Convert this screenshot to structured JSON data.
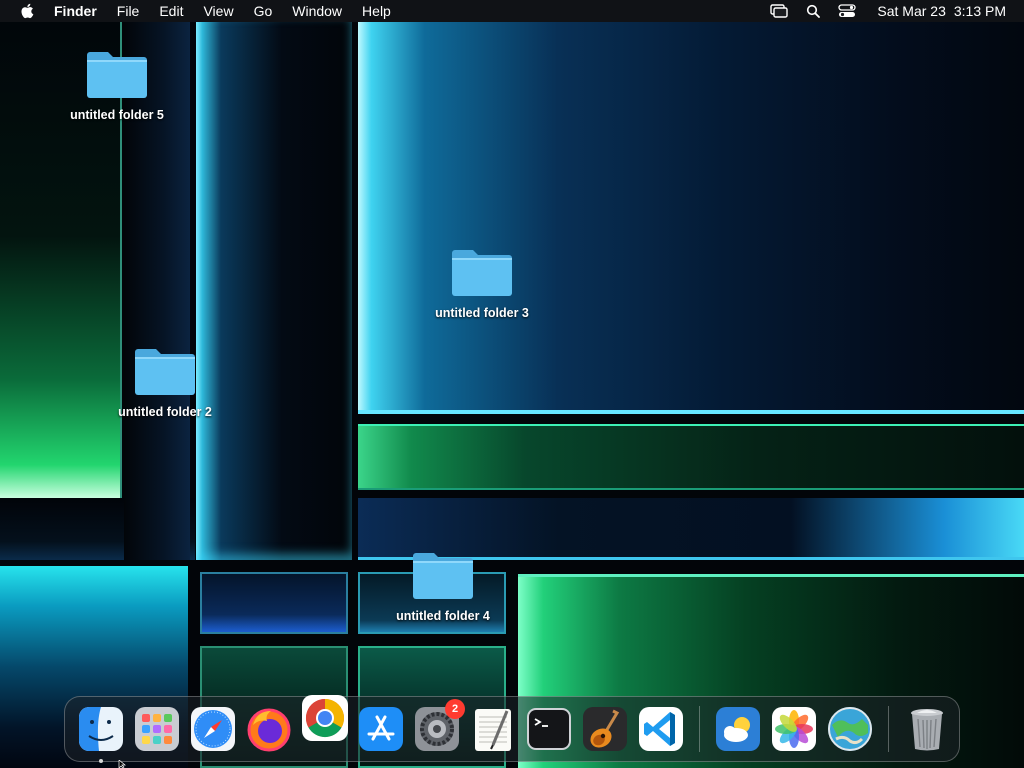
{
  "menubar": {
    "app_name": "Finder",
    "menus": [
      "File",
      "Edit",
      "View",
      "Go",
      "Window",
      "Help"
    ],
    "status_icons": [
      "screen-mirroring-icon",
      "spotlight-search-icon",
      "control-center-icon"
    ],
    "clock": {
      "date": "Sat Mar 23",
      "time": "3:13 PM"
    }
  },
  "desktop": {
    "folders": [
      {
        "name": "untitled folder 5"
      },
      {
        "name": "untitled folder 3"
      },
      {
        "name": "untitled folder 2"
      },
      {
        "name": "untitled folder 4"
      }
    ]
  },
  "dock": {
    "apps": [
      {
        "name": "Finder",
        "icon": "finder-icon",
        "running": true
      },
      {
        "name": "Launchpad",
        "icon": "launchpad-icon"
      },
      {
        "name": "Safari",
        "icon": "safari-icon"
      },
      {
        "name": "Firefox",
        "icon": "firefox-icon"
      },
      {
        "name": "Google Chrome",
        "icon": "chrome-icon"
      },
      {
        "name": "App Store",
        "icon": "app-store-icon"
      },
      {
        "name": "System Settings",
        "icon": "system-settings-icon",
        "badge": "2"
      },
      {
        "name": "TextEdit",
        "icon": "textedit-icon"
      },
      {
        "name": "Terminal",
        "icon": "terminal-icon"
      },
      {
        "name": "GarageBand",
        "icon": "garageband-icon"
      },
      {
        "name": "Visual Studio Code",
        "icon": "vscode-icon"
      },
      {
        "name": "Weather",
        "icon": "weather-icon"
      },
      {
        "name": "Photos",
        "icon": "photos-icon"
      },
      {
        "name": "Maps",
        "icon": "maps-icon"
      },
      {
        "name": "Trash",
        "icon": "trash-icon"
      }
    ]
  },
  "colors": {
    "folder_blue": "#5ec1f2",
    "folder_tab": "#4aa8dd",
    "badge_red": "#ff3b30",
    "menubar_bg": "#121418"
  }
}
